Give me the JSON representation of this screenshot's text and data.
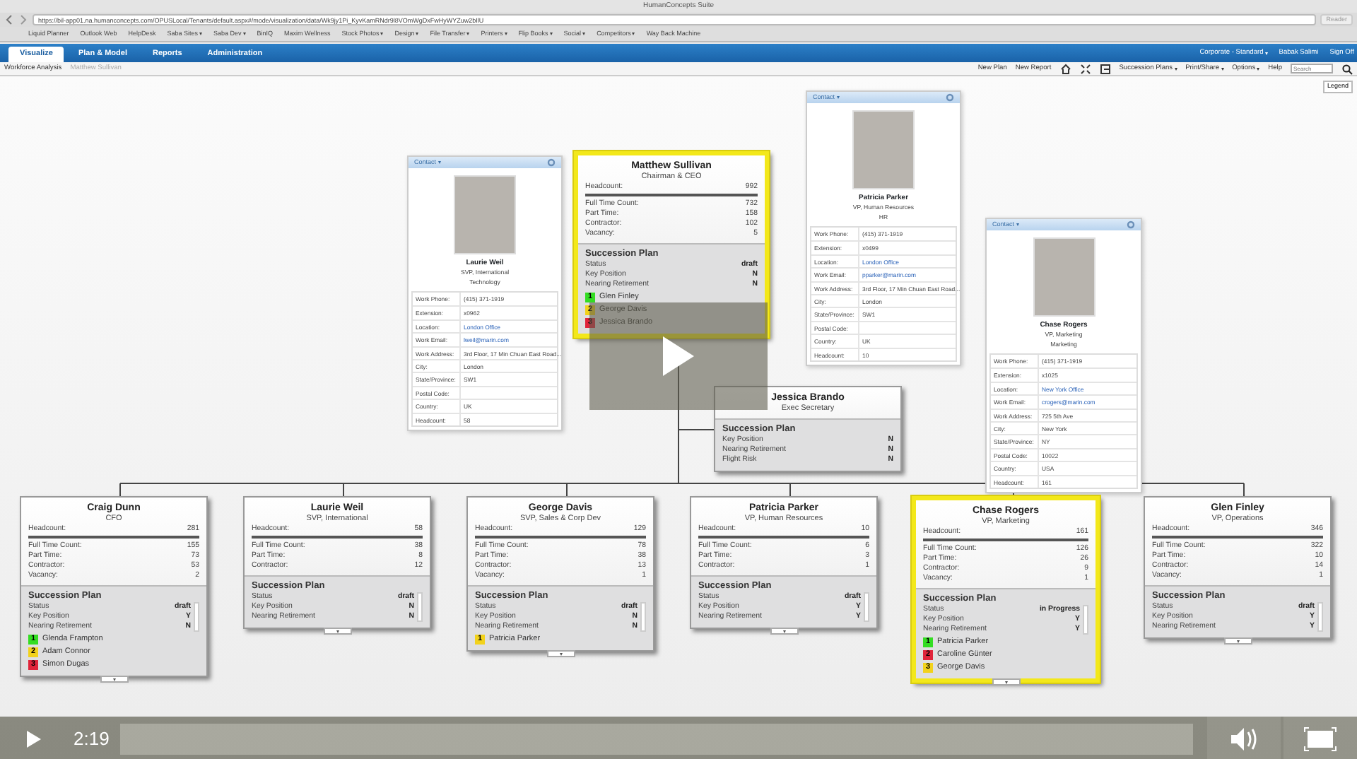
{
  "browser": {
    "title": "HumanConcepts Suite",
    "url": "https://bil-app01.na.humanconcepts.com/OPUSLocal/Tenants/default.aspx#/mode/visualization/data/Wk9jy1Pi_KyvKamRNdr9l8VOmWgDxFwHyWYZuw2bIlU",
    "reader": "Reader",
    "bookmarks": [
      {
        "label": "Liquid Planner",
        "dropdown": false
      },
      {
        "label": "Outlook Web",
        "dropdown": false
      },
      {
        "label": "HelpDesk",
        "dropdown": false
      },
      {
        "label": "Saba Sites",
        "dropdown": true
      },
      {
        "label": "Saba Dev",
        "dropdown": true
      },
      {
        "label": "BinIQ",
        "dropdown": false
      },
      {
        "label": "Maxim Wellness",
        "dropdown": false
      },
      {
        "label": "Stock Photos",
        "dropdown": true
      },
      {
        "label": "Design",
        "dropdown": true
      },
      {
        "label": "File Transfer",
        "dropdown": true
      },
      {
        "label": "Printers",
        "dropdown": true
      },
      {
        "label": "Flip Books",
        "dropdown": true
      },
      {
        "label": "Social",
        "dropdown": true
      },
      {
        "label": "Competitors",
        "dropdown": true
      },
      {
        "label": "Way Back Machine",
        "dropdown": false
      }
    ]
  },
  "app": {
    "tabs": [
      {
        "label": "Visualize",
        "selected": true
      },
      {
        "label": "Plan & Model",
        "selected": false
      },
      {
        "label": "Reports",
        "selected": false
      },
      {
        "label": "Administration",
        "selected": false
      }
    ],
    "account": [
      {
        "label": "Corporate - Standard",
        "dropdown": true
      },
      {
        "label": "Babak Salimi",
        "dropdown": false
      },
      {
        "label": "Sign Off",
        "dropdown": false
      }
    ],
    "breadcrumb": [
      "Workforce Analysis",
      "Matthew Sullivan"
    ],
    "actions": [
      "New Plan",
      "New Report"
    ],
    "menus": [
      {
        "label": "Succession Plans",
        "dropdown": true
      },
      {
        "label": "Print/Share",
        "dropdown": true
      },
      {
        "label": "Options",
        "dropdown": true
      },
      {
        "label": "Help",
        "dropdown": false
      }
    ],
    "search": {
      "placeholder": "Search"
    },
    "legend": "Legend"
  },
  "org_chart": {
    "top": {
      "name": "Matthew Sullivan",
      "title": "Chairman & CEO",
      "highlighted": true,
      "headcount": {
        "label": "Headcount:",
        "value": "992"
      },
      "breakdown": [
        {
          "label": "Full Time Count:",
          "value": "732"
        },
        {
          "label": "Part Time:",
          "value": "158"
        },
        {
          "label": "Contractor:",
          "value": "102"
        },
        {
          "label": "Vacancy:",
          "value": "5"
        }
      ],
      "plan": {
        "title": "Succession Plan",
        "rows": [
          {
            "label": "Status",
            "value": "draft"
          },
          {
            "label": "Key Position",
            "value": "N"
          },
          {
            "label": "Nearing Retirement",
            "value": "N"
          }
        ],
        "successors": [
          {
            "rank": "1",
            "name": "Glen Finley",
            "color": "#33dd22"
          },
          {
            "rank": "2",
            "name": "George Davis",
            "color": "#f2d21b"
          },
          {
            "rank": "3",
            "name": "Jessica Brando",
            "color": "#e0243a"
          }
        ]
      }
    },
    "contacts": [
      {
        "header": "Contact",
        "name": "Laurie Weil",
        "title": "SVP, International",
        "department": "Technology",
        "fields": [
          {
            "label": "Work Phone:",
            "value": "(415) 371-1919",
            "link": false
          },
          {
            "label": "Extension:",
            "value": "x0962",
            "link": false
          },
          {
            "label": "Location:",
            "value": "London Office",
            "link": true
          },
          {
            "label": "Work Email:",
            "value": "lweil@marin.com",
            "link": true
          },
          {
            "label": "Work Address:",
            "value": "3rd Floor, 17 Min Chuan East Road...",
            "link": false
          },
          {
            "label": "City:",
            "value": "London",
            "link": false
          },
          {
            "label": "State/Province:",
            "value": "SW1",
            "link": false
          },
          {
            "label": "Postal Code:"
          },
          {
            "label": "Country:",
            "value": "UK",
            "link": false
          },
          {
            "label": "Headcount:",
            "value": "58",
            "link": false
          }
        ]
      },
      {
        "header": "Contact",
        "name": "Patricia Parker",
        "title": "VP, Human Resources",
        "department": "HR",
        "fields": [
          {
            "label": "Work Phone:",
            "value": "(415) 371-1919",
            "link": false
          },
          {
            "label": "Extension:",
            "value": "x0499",
            "link": false
          },
          {
            "label": "Location:",
            "value": "London Office",
            "link": true
          },
          {
            "label": "Work Email:",
            "value": "pparker@marin.com",
            "link": true
          },
          {
            "label": "Work Address:",
            "value": "3rd Floor, 17 Min Chuan East Road...",
            "link": false
          },
          {
            "label": "City:",
            "value": "London",
            "link": false
          },
          {
            "label": "State/Province:",
            "value": "SW1",
            "link": false
          },
          {
            "label": "Postal Code:"
          },
          {
            "label": "Country:",
            "value": "UK",
            "link": false
          },
          {
            "label": "Headcount:",
            "value": "10",
            "link": false
          }
        ]
      },
      {
        "header": "Contact",
        "name": "Chase Rogers",
        "title": "VP, Marketing",
        "department": "Marketing",
        "fields": [
          {
            "label": "Work Phone:",
            "value": "(415) 371-1919",
            "link": false
          },
          {
            "label": "Extension:",
            "value": "x1025",
            "link": false
          },
          {
            "label": "Location:",
            "value": "New York Office",
            "link": true
          },
          {
            "label": "Work Email:",
            "value": "crogers@marin.com",
            "link": true
          },
          {
            "label": "Work Address:",
            "value": "725 5th Ave",
            "link": false
          },
          {
            "label": "City:",
            "value": "New York",
            "link": false
          },
          {
            "label": "State/Province:",
            "value": "NY",
            "link": false
          },
          {
            "label": "Postal Code:",
            "value": "10022",
            "link": false
          },
          {
            "label": "Country:",
            "value": "USA",
            "link": false
          },
          {
            "label": "Headcount:",
            "value": "161",
            "link": false
          }
        ]
      }
    ],
    "assistant": {
      "name": "Jessica Brando",
      "title": "Exec Secretary",
      "plan": {
        "title": "Succession Plan",
        "rows": [
          {
            "label": "Key Position",
            "value": "N"
          },
          {
            "label": "Nearing Retirement",
            "value": "N"
          },
          {
            "label": "Flight Risk",
            "value": "N"
          }
        ]
      }
    },
    "reports": [
      {
        "name": "Craig Dunn",
        "title": "CFO",
        "highlighted": false,
        "headcount": {
          "label": "Headcount:",
          "value": "281"
        },
        "breakdown": [
          {
            "label": "Full Time Count:",
            "value": "155"
          },
          {
            "label": "Part Time:",
            "value": "73"
          },
          {
            "label": "Contractor:",
            "value": "53"
          },
          {
            "label": "Vacancy:",
            "value": "2"
          }
        ],
        "plan": {
          "title": "Succession Plan",
          "rows": [
            {
              "label": "Status",
              "value": "draft"
            },
            {
              "label": "Key Position",
              "value": "Y"
            },
            {
              "label": "Nearing Retirement",
              "value": "N"
            }
          ],
          "successors": [
            {
              "rank": "1",
              "name": "Glenda Frampton",
              "color": "#33dd22"
            },
            {
              "rank": "2",
              "name": "Adam Connor",
              "color": "#f2d21b"
            },
            {
              "rank": "3",
              "name": "Simon Dugas",
              "color": "#e0243a"
            }
          ]
        }
      },
      {
        "name": "Laurie Weil",
        "title": "SVP, International",
        "highlighted": false,
        "headcount": {
          "label": "Headcount:",
          "value": "58"
        },
        "breakdown": [
          {
            "label": "Full Time Count:",
            "value": "38"
          },
          {
            "label": "Part Time:",
            "value": "8"
          },
          {
            "label": "Contractor:",
            "value": "12"
          }
        ],
        "plan": {
          "title": "Succession Plan",
          "rows": [
            {
              "label": "Status",
              "value": "draft"
            },
            {
              "label": "Key Position",
              "value": "N"
            },
            {
              "label": "Nearing Retirement",
              "value": "N"
            }
          ]
        }
      },
      {
        "name": "George Davis",
        "title": "SVP, Sales & Corp Dev",
        "highlighted": false,
        "headcount": {
          "label": "Headcount:",
          "value": "129"
        },
        "breakdown": [
          {
            "label": "Full Time Count:",
            "value": "78"
          },
          {
            "label": "Part Time:",
            "value": "38"
          },
          {
            "label": "Contractor:",
            "value": "13"
          },
          {
            "label": "Vacancy:",
            "value": "1"
          }
        ],
        "plan": {
          "title": "Succession Plan",
          "rows": [
            {
              "label": "Status",
              "value": "draft"
            },
            {
              "label": "Key Position",
              "value": "N"
            },
            {
              "label": "Nearing Retirement",
              "value": "N"
            }
          ],
          "successors": [
            {
              "rank": "1",
              "name": "Patricia Parker",
              "color": "#f2d21b"
            }
          ]
        }
      },
      {
        "name": "Patricia Parker",
        "title": "VP, Human Resources",
        "highlighted": false,
        "headcount": {
          "label": "Headcount:",
          "value": "10"
        },
        "breakdown": [
          {
            "label": "Full Time Count:",
            "value": "6"
          },
          {
            "label": "Part Time:",
            "value": "3"
          },
          {
            "label": "Contractor:",
            "value": "1"
          }
        ],
        "plan": {
          "title": "Succession Plan",
          "rows": [
            {
              "label": "Status",
              "value": "draft"
            },
            {
              "label": "Key Position",
              "value": "Y"
            },
            {
              "label": "Nearing Retirement",
              "value": "Y"
            }
          ]
        }
      },
      {
        "name": "Chase Rogers",
        "title": "VP, Marketing",
        "highlighted": true,
        "headcount": {
          "label": "Headcount:",
          "value": "161"
        },
        "breakdown": [
          {
            "label": "Full Time Count:",
            "value": "126"
          },
          {
            "label": "Part Time:",
            "value": "26"
          },
          {
            "label": "Contractor:",
            "value": "9"
          },
          {
            "label": "Vacancy:",
            "value": "1"
          }
        ],
        "plan": {
          "title": "Succession Plan",
          "rows": [
            {
              "label": "Status",
              "value": "in Progress"
            },
            {
              "label": "Key Position",
              "value": "Y"
            },
            {
              "label": "Nearing Retirement",
              "value": "Y"
            }
          ],
          "successors": [
            {
              "rank": "1",
              "name": "Patricia Parker",
              "color": "#33dd22"
            },
            {
              "rank": "2",
              "name": "Caroline Günter",
              "color": "#e0243a"
            },
            {
              "rank": "3",
              "name": "George Davis",
              "color": "#f2d21b"
            }
          ]
        }
      },
      {
        "name": "Glen Finley",
        "title": "VP, Operations",
        "highlighted": false,
        "headcount": {
          "label": "Headcount:",
          "value": "346"
        },
        "breakdown": [
          {
            "label": "Full Time Count:",
            "value": "322"
          },
          {
            "label": "Part Time:",
            "value": "10"
          },
          {
            "label": "Contractor:",
            "value": "14"
          },
          {
            "label": "Vacancy:",
            "value": "1"
          }
        ],
        "plan": {
          "title": "Succession Plan",
          "rows": [
            {
              "label": "Status",
              "value": "draft"
            },
            {
              "label": "Key Position",
              "value": "Y"
            },
            {
              "label": "Nearing Retirement",
              "value": "Y"
            }
          ]
        }
      }
    ]
  },
  "video": {
    "time": "2:19"
  }
}
